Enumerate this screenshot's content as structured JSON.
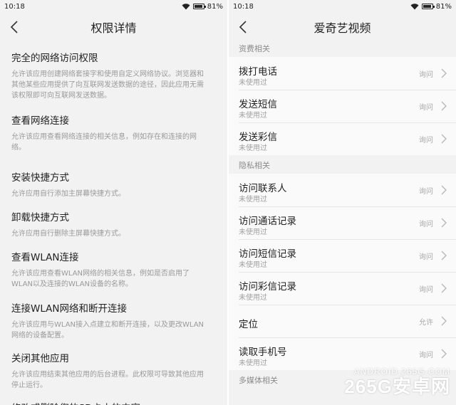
{
  "left": {
    "status": {
      "time": "10:18",
      "battery": "81%",
      "battery_level": 0.81
    },
    "title": "权限详情",
    "permissions": [
      {
        "title": "完全的网络访问权限",
        "desc": [
          "允许该应用创建网络套接字和使用自定义网络协议。浏览器和",
          "其他某些应用提供了向互联网发送数据的途径，因此应用无需",
          "该权限即可向互联网发送数据。"
        ]
      },
      {
        "title": "查看网络连接",
        "desc": [
          "允许该应用查看网络连接的相关信息，例如存在和连接的网",
          "络。"
        ]
      },
      {
        "title": "安装快捷方式",
        "desc": [
          "允许应用自行添加主屏幕快捷方式。"
        ]
      },
      {
        "title": "卸载快捷方式",
        "desc": [
          "允许应用自行删除主屏幕快捷方式。"
        ]
      },
      {
        "title": "查看WLAN连接",
        "desc": [
          "允许该应用查看WLAN网络的相关信息，例如是否启用了",
          "WLAN以及连接的WLAN设备的名称。"
        ]
      },
      {
        "title": "连接WLAN网络和断开连接",
        "desc": [
          "允许该应用与WLAN接入点建立和断开连接，以及更改WLAN",
          "网络的设备配置。"
        ]
      },
      {
        "title": "关闭其他应用",
        "desc": [
          "允许该应用结束其他应用的后台进程。此权限可导致其他应用",
          "停止运行。"
        ]
      },
      {
        "title": "修改或删除您的SD卡中的内容",
        "desc": []
      }
    ]
  },
  "right": {
    "status": {
      "time": "10:18",
      "battery": "81%",
      "battery_level": 0.81
    },
    "title": "爱奇艺视频",
    "sections": [
      {
        "label": "资费相关",
        "rows": [
          {
            "title": "拨打电话",
            "sub": "未使用过",
            "status": "询问"
          },
          {
            "title": "发送短信",
            "sub": "未使用过",
            "status": "询问"
          },
          {
            "title": "发送彩信",
            "sub": "未使用过",
            "status": "询问"
          }
        ]
      },
      {
        "label": "隐私相关",
        "rows": [
          {
            "title": "访问联系人",
            "sub": "未使用过",
            "status": "询问"
          },
          {
            "title": "访问通话记录",
            "sub": "未使用过",
            "status": "询问"
          },
          {
            "title": "访问短信记录",
            "sub": "未使用过",
            "status": "询问"
          },
          {
            "title": "访问彩信记录",
            "sub": "未使用过",
            "status": "询问"
          },
          {
            "title": "定位",
            "sub": "",
            "status": "允许"
          },
          {
            "title": "读取手机号",
            "sub": "未使用过",
            "status": "询问"
          }
        ]
      },
      {
        "label": "多媒体相关",
        "rows": []
      }
    ]
  },
  "watermark": {
    "line1": "ANDROID.265G.COM",
    "line2": "265G安卓网"
  },
  "icons": {
    "back": "back-arrow-icon",
    "chevron": "chevron-right-icon",
    "wifi": "wifi-icon",
    "battery": "battery-icon"
  }
}
